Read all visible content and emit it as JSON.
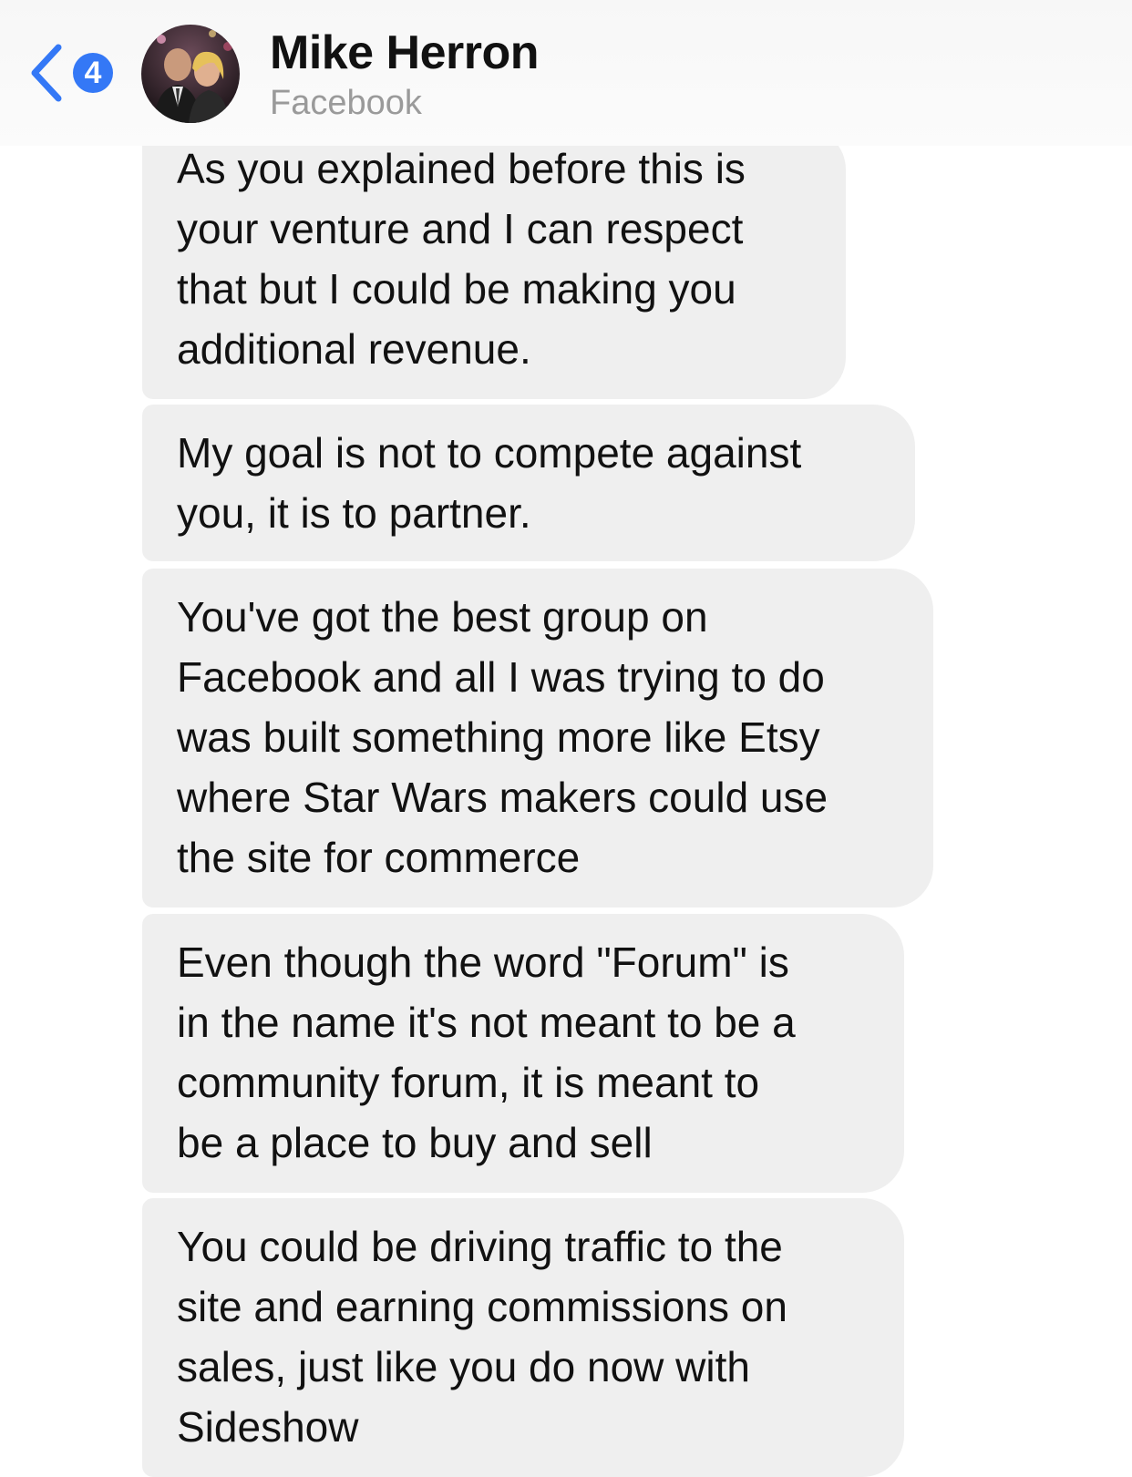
{
  "header": {
    "unread_count": "4",
    "contact_name": "Mike Herron",
    "contact_subtitle": "Facebook",
    "back_icon": "chevron-left-icon",
    "accent_color": "#3478f6"
  },
  "messages": [
    {
      "text": "As you explained before this is\nyour venture and I can respect\nthat but I could be making you\nadditional revenue."
    },
    {
      "text": "My goal is not to compete against\nyou, it is to partner."
    },
    {
      "text": "You've got the best group on\nFacebook and all I was trying to do\nwas built something more like Etsy\nwhere Star Wars makers could use\nthe site for commerce"
    },
    {
      "text": "Even though the word \"Forum\" is\nin the name it's not meant to be a\ncommunity forum, it is meant to\nbe a place to buy and sell"
    },
    {
      "text": "You could be driving traffic to the\nsite and earning commissions on\nsales, just like you do now with\nSideshow"
    }
  ],
  "bubble_color": "#efefef"
}
